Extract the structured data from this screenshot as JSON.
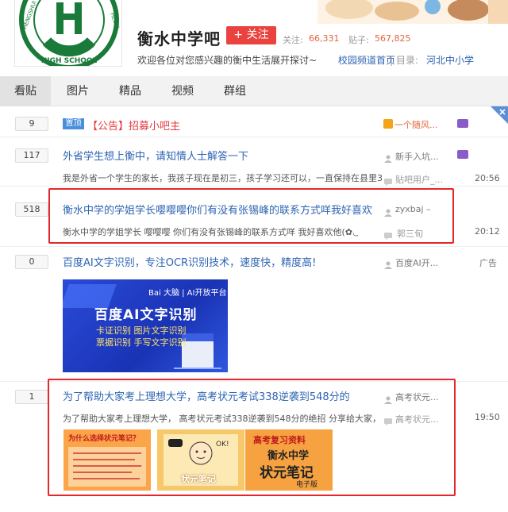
{
  "header": {
    "forum_name": "衡水中学吧",
    "follow_label": "+ 关注",
    "followers_label": "关注:",
    "followers_count": "66,331",
    "posts_label": "贴子:",
    "posts_count": "567,825",
    "slogan": "欢迎各位对您感兴趣的衡中生活展开探讨~",
    "directory_link": "校园频道首页",
    "directory_sep": "| 目录:",
    "directory_category": "河北中小学",
    "logo_text": "HENGSHUI HIGH SCHOOL HEBEI"
  },
  "tabs": [
    {
      "label": "看贴",
      "active": true
    },
    {
      "label": "图片"
    },
    {
      "label": "精品"
    },
    {
      "label": "视频"
    },
    {
      "label": "群组"
    }
  ],
  "threads": [
    {
      "reply_count": "9",
      "tag": "置顶",
      "title": "【公告】招募小吧主",
      "author": "一个随风..."
    },
    {
      "reply_count": "117",
      "title": "外省学生想上衡中，请知情人士解答一下",
      "abstract": "我是外省一个学生的家长，我孩子现在是初三，孩子学习还可以，一直保持在县里30...",
      "author": "新手入坑...",
      "last_reply": "贴吧用户_...",
      "time": "20:56"
    },
    {
      "reply_count": "518",
      "title": "衡水中学的学姐学长嘤嘤嘤你们有没有张锡峰的联系方式咩我好喜欢",
      "abstract": "衡水中学的学姐学长 嘤嘤嘤 你们有没有张锡峰的联系方式咩 我好喜欢他(✿◡‿◡)",
      "author": "zyxbaj –",
      "last_reply": "郭三旬",
      "time": "20:12"
    },
    {
      "reply_count": "0",
      "title": "百度AI文字识别，专注OCR识别技术，速度快，精度高!",
      "author": "百度AI开...",
      "ad_label": "广告",
      "ad_brand": "Bai 大脑 | AI开放平台",
      "ad_headline": "百度AI文字识别",
      "ad_line1": "卡证识别  图片文字识别",
      "ad_line2": "票据识别  手写文字识别"
    },
    {
      "reply_count": "1",
      "title": "为了帮助大家考上理想大学，高考状元考试338逆袭到548分的",
      "abstract": "为了帮助大家考上理想大学，  高考状元考试338逆袭到548分的绝招 分享给大家，祝...",
      "author": "高考状元...",
      "last_reply": "高考状元...",
      "time": "19:50",
      "thumb1_title": "为什么选择状元笔记？",
      "thumb2_title": "状元笔记",
      "thumb2_tag": "OK!",
      "thumb3_top": "高考复习资料",
      "thumb3_mid": "衡水中学",
      "thumb3_big": "状元笔记",
      "thumb3_small": "电子版"
    }
  ]
}
